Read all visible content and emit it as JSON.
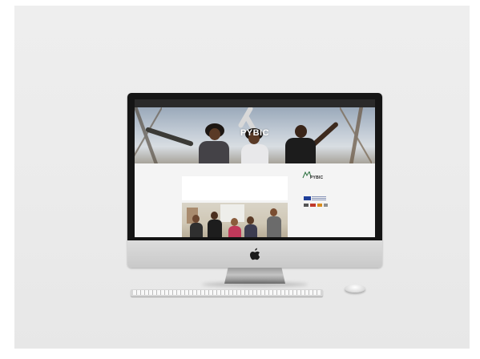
{
  "site": {
    "nav_links": [
      "",
      "",
      "",
      "",
      "",
      "",
      ""
    ],
    "logo_mark": "PYBIC",
    "logo_sub": "",
    "post": {
      "category": "",
      "title": "",
      "date": ""
    },
    "sidebar": {
      "logo_text": "PYBIC",
      "logo_sub": "",
      "partners_heading": "",
      "recent_heading": "",
      "recent_item": ""
    }
  },
  "icons": {
    "brand": "apple-logo-icon",
    "eu_flag": "eu-flag-icon"
  },
  "colors": {
    "bezel": "#151515",
    "aluminium": "#d4d4d4",
    "nav_bar": "#2a2a2a",
    "accent_red": "#c0392b",
    "eu_blue": "#1f3f9a"
  }
}
